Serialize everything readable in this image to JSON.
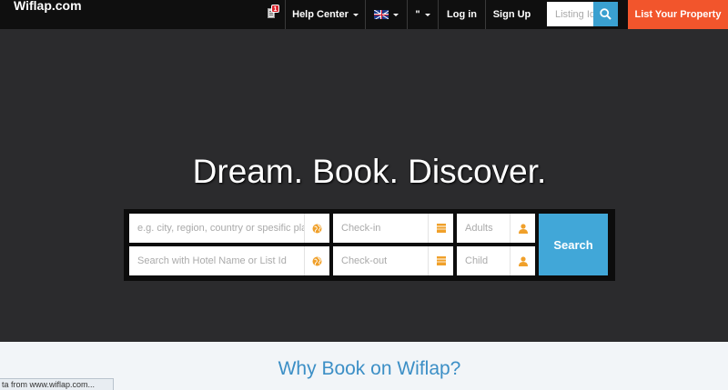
{
  "navbar": {
    "brand": "Wiflap.com",
    "notification_count": "1",
    "help_center": "Help Center",
    "language_icon": "uk-flag-icon",
    "currency": "\"",
    "login": "Log in",
    "signup": "Sign Up",
    "search_placeholder": "Listing Id",
    "list_property": "List Your Property"
  },
  "hero": {
    "title": "Dream. Book. Discover."
  },
  "search_form": {
    "destination_placeholder": "e.g. city, region, country or spesific place",
    "hotel_placeholder": "Search with Hotel Name or List Id",
    "checkin_placeholder": "Check-in",
    "checkout_placeholder": "Check-out",
    "adults_placeholder": "Adults",
    "child_placeholder": "Child",
    "search_label": "Search"
  },
  "section": {
    "why_title": "Why Book on Wiflap?"
  },
  "status": {
    "text": "ta from www.wiflap.com..."
  },
  "colors": {
    "navbar_bg": "#0f0f0f",
    "hero_bg": "#2b2b2d",
    "accent_orange": "#f2552c",
    "accent_blue": "#41a7d8",
    "icon_orange": "#f0a02a",
    "heading_blue": "#3c8fc6"
  }
}
